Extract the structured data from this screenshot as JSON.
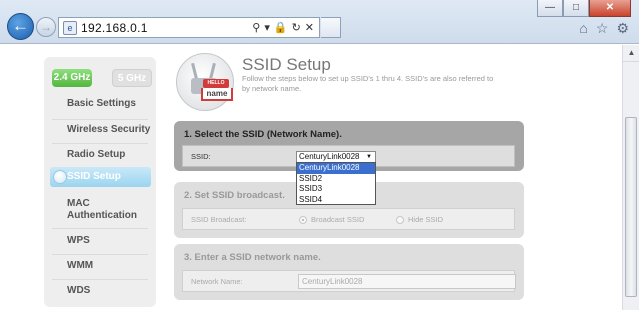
{
  "browser": {
    "url": "192.168.0.1",
    "back_glyph": "←",
    "forward_glyph": "→",
    "address_icons": [
      "search-icon",
      "lock-icon",
      "refresh-icon",
      "stop-icon"
    ],
    "window_buttons": [
      "minimize",
      "restore",
      "close"
    ],
    "window_glyphs": {
      "minimize": "—",
      "restore": "□",
      "close": "✕"
    },
    "toolbar_icons": [
      "home-icon",
      "favorites-icon",
      "tools-icon"
    ]
  },
  "nav": {
    "bands": {
      "band_24": "2.4 GHz",
      "band_5": "5 GHz"
    },
    "items": [
      {
        "label": "Basic Settings"
      },
      {
        "label": "Wireless Security"
      },
      {
        "label": "Radio Setup"
      },
      {
        "label": "SSID Setup",
        "active": true
      },
      {
        "label": "MAC Authentication"
      },
      {
        "label": "WPS"
      },
      {
        "label": "WMM"
      },
      {
        "label": "WDS"
      }
    ]
  },
  "header": {
    "title": "SSID Setup",
    "description": "Follow the steps below to set up SSID's 1 thru 4. SSID's are also referred to by network name.",
    "icon_tag_top": "HELLO",
    "icon_tag_bottom": "name"
  },
  "step1": {
    "title": "1. Select the SSID (Network Name).",
    "ssid_label": "SSID:",
    "ssid_selected": "CenturyLink0028",
    "ssid_options": [
      "CenturyLink0028",
      "SSID2",
      "SSID3",
      "SSID4"
    ]
  },
  "step2": {
    "title": "2. Set SSID broadcast.",
    "broadcast_label": "SSID Broadcast:",
    "option_broadcast": "Broadcast SSID",
    "option_hide": "Hide SSID",
    "selected": "Broadcast SSID"
  },
  "step3": {
    "title": "3. Enter a SSID network name.",
    "network_label": "Network Name:",
    "network_value": "CenturyLink0028"
  },
  "colors": {
    "active_band": "#53b53f",
    "active_nav": "#9bd4f0",
    "dropdown_highlight": "#3a6fd0",
    "panel_active": "#a6a6a6",
    "panel_disabled": "#dedede"
  }
}
